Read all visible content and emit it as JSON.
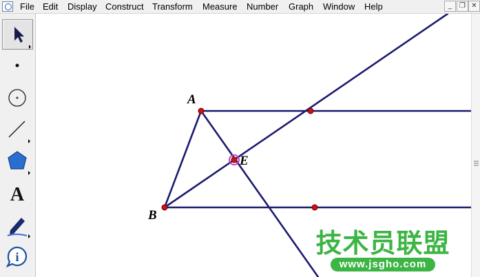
{
  "menubar": {
    "items": [
      {
        "label": "File"
      },
      {
        "label": "Edit"
      },
      {
        "label": "Display"
      },
      {
        "label": "Construct"
      },
      {
        "label": "Transform"
      },
      {
        "label": "Measure"
      },
      {
        "label": "Number"
      },
      {
        "label": "Graph"
      },
      {
        "label": "Window"
      },
      {
        "label": "Help"
      }
    ],
    "window_buttons": {
      "minimize": "_",
      "restore": "❐",
      "close": "✕"
    }
  },
  "toolbox": {
    "tools": [
      {
        "name": "arrow-select-tool",
        "icon": "arrow-icon",
        "selected": true
      },
      {
        "name": "point-tool",
        "icon": "point-icon"
      },
      {
        "name": "compass-tool",
        "icon": "circle-icon"
      },
      {
        "name": "straightedge-tool",
        "icon": "segment-icon"
      },
      {
        "name": "polygon-tool",
        "icon": "pentagon-icon"
      },
      {
        "name": "text-tool",
        "icon": "text-A-icon",
        "glyph": "A"
      },
      {
        "name": "marker-tool",
        "icon": "marker-pen-icon"
      },
      {
        "name": "information-tool",
        "icon": "info-icon",
        "glyph": "i"
      }
    ]
  },
  "canvas": {
    "colors": {
      "line": "#1a1a6e",
      "point": "#cc1111",
      "highlight": "#c040c0"
    },
    "labels": {
      "A": "A",
      "B": "B",
      "E": "E"
    }
  },
  "watermark": {
    "chinese": "技术员联盟",
    "url": "www.jsgho.com",
    "color": "#3cb544"
  }
}
